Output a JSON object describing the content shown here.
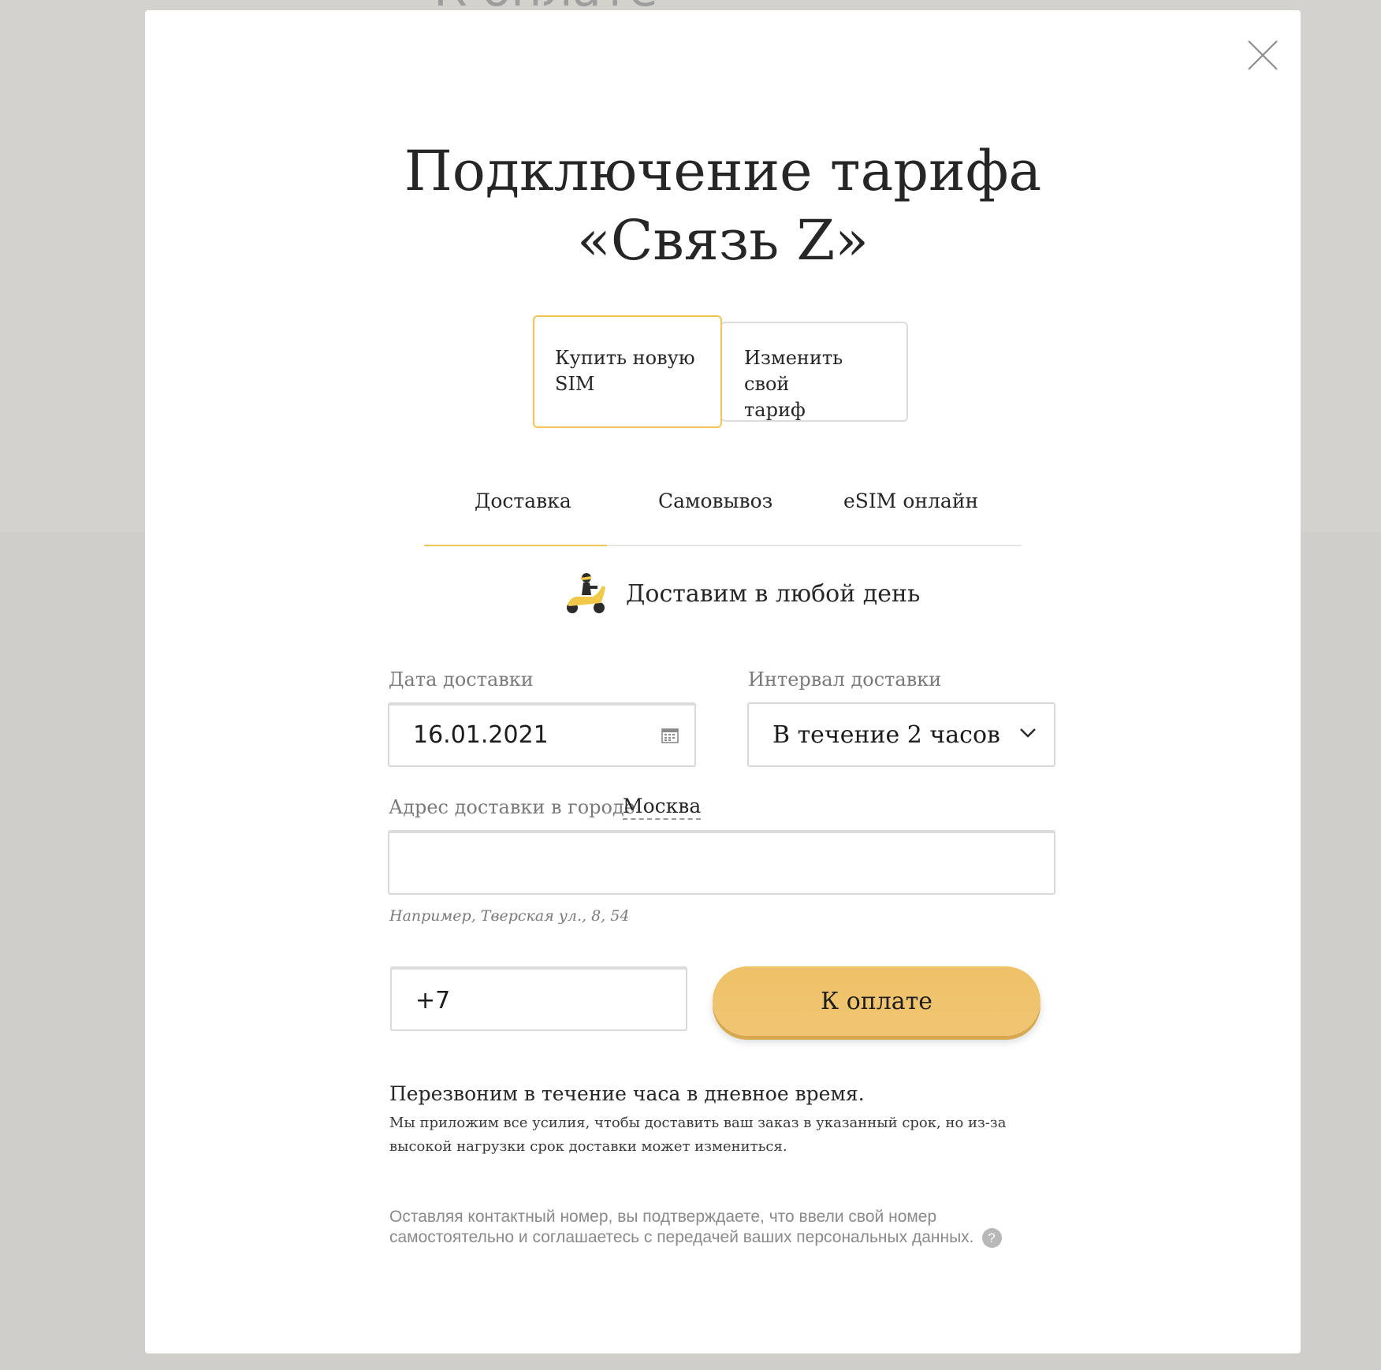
{
  "background": {
    "heading": "К оплате"
  },
  "modal": {
    "title_line1": "Подключение тарифа",
    "title_line2": "«Связь Z»",
    "sim_options": [
      {
        "label_line1": "Купить новую",
        "label_line2": "SIM",
        "selected": true
      },
      {
        "label_line1": "Изменить свой",
        "label_line2": "тариф",
        "selected": false
      }
    ],
    "tabs": [
      {
        "label": "Доставка",
        "active": true
      },
      {
        "label": "Самовывоз",
        "active": false
      },
      {
        "label": "eSIM онлайн",
        "active": false
      }
    ],
    "promo": {
      "text": "Доставим в любой день",
      "icon": "scooter-courier-icon"
    },
    "form": {
      "date_label": "Дата доставки",
      "date_value": "16.01.2021",
      "interval_label": "Интервал доставки",
      "interval_value": "В течение 2 часов",
      "address_label": "Адрес доставки в городе",
      "city": "Москва",
      "address_value": "",
      "address_hint": "Например, Тверская ул., 8, 54",
      "phone_value": "+7",
      "submit_label": "К оплате"
    },
    "callback_text": "Перезвоним в течение часа в дневное время.",
    "note_text": "Мы приложим все усилия, чтобы доставить ваш заказ в указанный срок, но из-за высокой нагрузки срок доставки может измениться.",
    "legal_text": "Оставляя контактный номер, вы подтверждаете, что ввели свой номер самостоятельно и соглашаетесь с передачей ваших персональных данных.",
    "help_symbol": "?"
  },
  "colors": {
    "accent": "#f3c456",
    "button": "#efc168",
    "overlay": "#d3d2cd"
  }
}
